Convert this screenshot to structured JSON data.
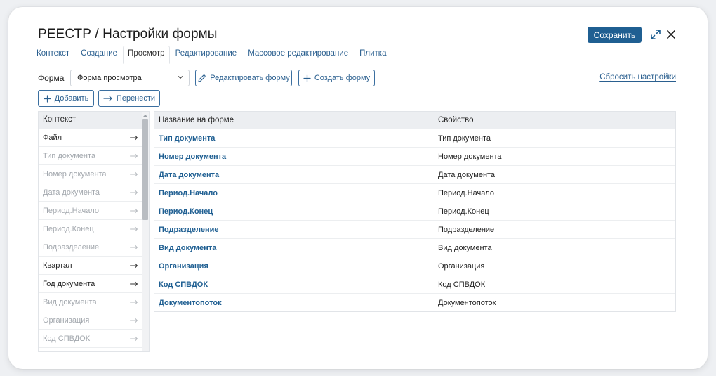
{
  "header": {
    "title": "РЕЕСТР / Настройки формы",
    "save_label": "Сохранить",
    "expand_icon": "expand-icon",
    "close_icon": "close-icon"
  },
  "tabs": [
    {
      "label": "Контекст"
    },
    {
      "label": "Создание"
    },
    {
      "label": "Просмотр",
      "active": true
    },
    {
      "label": "Редактирование"
    },
    {
      "label": "Массовое редактирование"
    },
    {
      "label": "Плитка"
    }
  ],
  "toolbar": {
    "form_label": "Форма",
    "form_select_value": "Форма просмотра",
    "edit_form_label": "Редактировать форму",
    "create_form_label": "Создать форму",
    "reset_label": "Сбросить настройки",
    "add_label": "Добавить",
    "move_label": "Перенести"
  },
  "context": {
    "header": "Контекст",
    "items": [
      {
        "label": "Файл",
        "enabled": true
      },
      {
        "label": "Тип документа",
        "enabled": false
      },
      {
        "label": "Номер документа",
        "enabled": false
      },
      {
        "label": "Дата документа",
        "enabled": false
      },
      {
        "label": "Период.Начало",
        "enabled": false
      },
      {
        "label": "Период.Конец",
        "enabled": false
      },
      {
        "label": "Подразделение",
        "enabled": false
      },
      {
        "label": "Квартал",
        "enabled": true
      },
      {
        "label": "Год документа",
        "enabled": true
      },
      {
        "label": "Вид документа",
        "enabled": false
      },
      {
        "label": "Организация",
        "enabled": false
      },
      {
        "label": "Код СПВДОК",
        "enabled": false
      }
    ]
  },
  "table": {
    "headers": {
      "name": "Название на форме",
      "property": "Свойство"
    },
    "rows": [
      {
        "name": "Тип документа",
        "property": "Тип документа"
      },
      {
        "name": "Номер документа",
        "property": "Номер документа"
      },
      {
        "name": "Дата документа",
        "property": "Дата документа"
      },
      {
        "name": "Период.Начало",
        "property": "Период.Начало"
      },
      {
        "name": "Период.Конец",
        "property": "Период.Конец"
      },
      {
        "name": "Подразделение",
        "property": "Подразделение"
      },
      {
        "name": "Вид документа",
        "property": "Вид документа"
      },
      {
        "name": "Организация",
        "property": "Организация"
      },
      {
        "name": "Код СПВДОК",
        "property": "Код СПВДОК"
      },
      {
        "name": "Документопоток",
        "property": "Документопоток"
      }
    ]
  },
  "colors": {
    "accent": "#1f5f92",
    "link": "#2a5f8f",
    "disabled_text": "#a3a8ae",
    "header_bg": "#eceef1"
  }
}
